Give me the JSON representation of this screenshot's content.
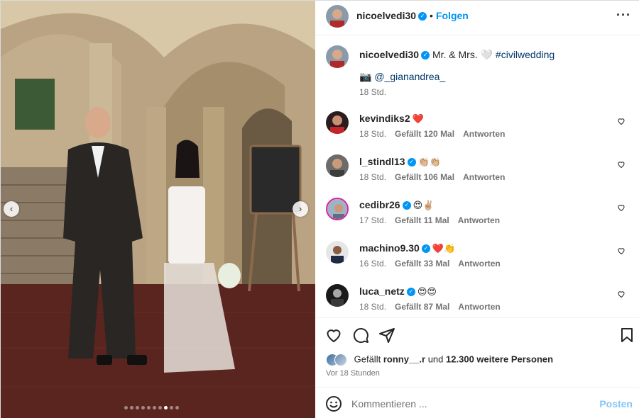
{
  "post": {
    "username": "nicoelvedi30",
    "follow_label": "Folgen",
    "more_icon": "more-horizontal-icon",
    "carousel": {
      "dot_count": 10,
      "active_index": 7
    }
  },
  "caption": {
    "username": "nicoelvedi30",
    "text": "Mr. & Mrs. 🤍",
    "hashtag": "#civilwedding",
    "camera_emoji": "📷",
    "mention": "@_gianandrea_",
    "time": "18 Std."
  },
  "comments": [
    {
      "username": "kevindiks2",
      "verified": false,
      "emoji": "❤️",
      "time": "18 Std.",
      "likes": "Gefällt 120 Mal",
      "reply": "Antworten"
    },
    {
      "username": "l_stindl13",
      "verified": true,
      "emoji": "👏🏼👏🏼",
      "time": "18 Std.",
      "likes": "Gefällt 106 Mal",
      "reply": "Antworten"
    },
    {
      "username": "cedibr26",
      "verified": true,
      "emoji": "😍✌🏼",
      "time": "17 Std.",
      "likes": "Gefällt 11 Mal",
      "reply": "Antworten"
    },
    {
      "username": "machino9.30",
      "verified": true,
      "emoji": "❤️👏",
      "time": "16 Std.",
      "likes": "Gefällt 33 Mal",
      "reply": "Antworten"
    },
    {
      "username": "luca_netz",
      "verified": true,
      "emoji": "😍😍",
      "time": "18 Std.",
      "likes": "Gefällt 87 Mal",
      "reply": "Antworten"
    }
  ],
  "likes": {
    "prefix": "Gefällt",
    "first_user": "ronny__.r",
    "connector": "und",
    "others": "12.300 weitere Personen",
    "ago": "Vor 18 Stunden"
  },
  "comment_box": {
    "placeholder": "Kommentieren ...",
    "post_label": "Posten"
  },
  "colors": {
    "accent": "#0095f6",
    "heart": "#ed4956",
    "muted": "#737373"
  }
}
